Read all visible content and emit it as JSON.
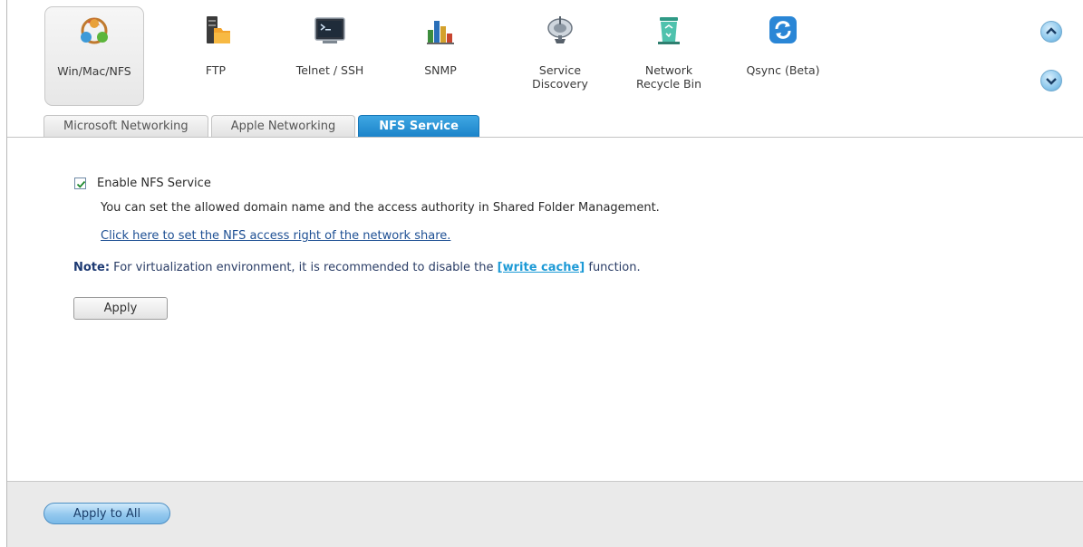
{
  "toolbar": {
    "items": [
      {
        "label": "Win/Mac/NFS",
        "icon": "network-share-icon",
        "active": true
      },
      {
        "label": "FTP",
        "icon": "ftp-server-icon"
      },
      {
        "label": "Telnet / SSH",
        "icon": "terminal-icon"
      },
      {
        "label": "SNMP",
        "icon": "bar-chart-icon"
      },
      {
        "label": "Service\nDiscovery",
        "icon": "satellite-dish-icon"
      },
      {
        "label": "Network\nRecycle Bin",
        "icon": "recycle-bin-icon"
      },
      {
        "label": "Qsync (Beta)",
        "icon": "sync-icon"
      }
    ],
    "scroll_up_icon": "chevron-up-icon",
    "scroll_down_icon": "chevron-down-icon"
  },
  "tabs": [
    {
      "label": "Microsoft Networking"
    },
    {
      "label": "Apple Networking"
    },
    {
      "label": "NFS Service",
      "active": true
    }
  ],
  "nfs": {
    "enable_label": "Enable NFS Service",
    "enabled": true,
    "description": "You can set the allowed domain name and the access authority in Shared Folder Management.",
    "link_text": "Click here to set the NFS access right of the network share.",
    "note_label": "Note:",
    "note_text_before": " For virtualization environment, it is recommended to disable the ",
    "note_link": "[write cache]",
    "note_text_after": " function.",
    "apply_label": "Apply"
  },
  "footer": {
    "apply_all_label": "Apply to All"
  },
  "colors": {
    "accent": "#1a82c8",
    "link": "#1d4f93",
    "note_link": "#1d9ad6",
    "footer_bg": "#eaeaea"
  }
}
